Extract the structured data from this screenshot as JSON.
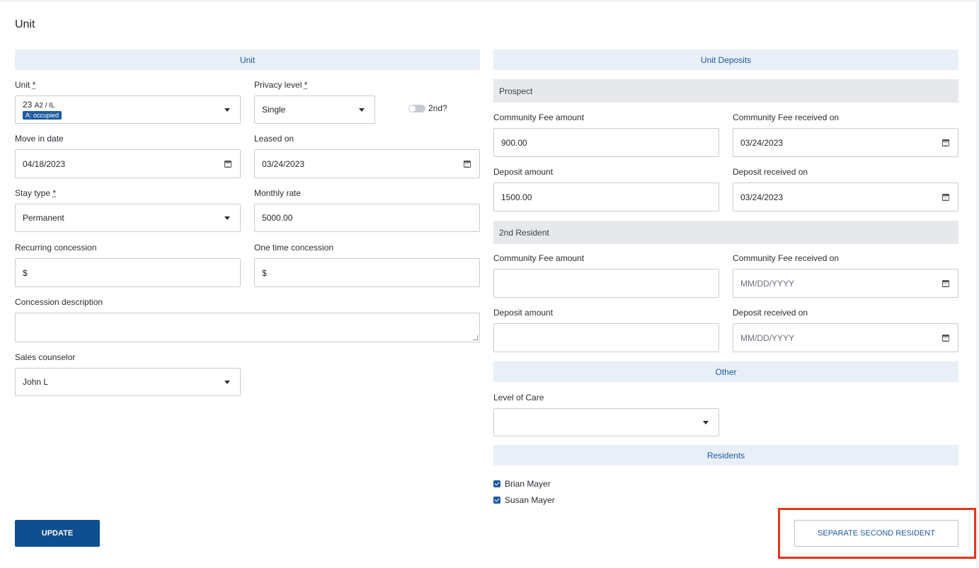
{
  "page": {
    "title": "Unit"
  },
  "left": {
    "section_title": "Unit",
    "unit": {
      "label": "Unit",
      "required": "*",
      "number": "23",
      "detail": "A2 / IL",
      "badge": "A: occupied"
    },
    "privacy": {
      "label": "Privacy level",
      "required": "*",
      "value": "Single",
      "toggle_label": "2nd?"
    },
    "move_in": {
      "label": "Move in date",
      "value": "04/18/2023"
    },
    "leased_on": {
      "label": "Leased on",
      "value": "03/24/2023"
    },
    "stay_type": {
      "label": "Stay type",
      "required": "*",
      "value": "Permanent"
    },
    "monthly_rate": {
      "label": "Monthly rate",
      "value": "5000.00"
    },
    "recurring_concession": {
      "label": "Recurring concession",
      "prefix": "$"
    },
    "one_time_concession": {
      "label": "One time concession",
      "prefix": "$"
    },
    "concession_description": {
      "label": "Concession description"
    },
    "sales_counselor": {
      "label": "Sales counselor",
      "value": "John L"
    },
    "update_button": "UPDATE"
  },
  "right": {
    "section_title": "Unit Deposits",
    "prospect": {
      "title": "Prospect",
      "community_fee_amount": {
        "label": "Community Fee amount",
        "value": "900.00"
      },
      "community_fee_received": {
        "label": "Community Fee received on",
        "value": "03/24/2023"
      },
      "deposit_amount": {
        "label": "Deposit amount",
        "value": "1500.00"
      },
      "deposit_received": {
        "label": "Deposit received on",
        "value": "03/24/2023"
      }
    },
    "second_resident": {
      "title": "2nd Resident",
      "community_fee_amount": {
        "label": "Community Fee amount",
        "value": ""
      },
      "community_fee_received": {
        "label": "Community Fee received on",
        "placeholder": "MM/DD/YYYY"
      },
      "deposit_amount": {
        "label": "Deposit amount",
        "value": ""
      },
      "deposit_received": {
        "label": "Deposit received on",
        "placeholder": "MM/DD/YYYY"
      }
    },
    "other": {
      "title": "Other",
      "level_of_care": {
        "label": "Level of Care",
        "value": ""
      }
    },
    "residents": {
      "title": "Residents",
      "items": [
        {
          "name": "Brian Mayer",
          "checked": true
        },
        {
          "name": "Susan Mayer",
          "checked": true
        }
      ]
    },
    "separate_button": "SEPARATE SECOND RESIDENT"
  },
  "colors": {
    "accent": "#1d5aa0",
    "primary_button": "#0f4f8f",
    "highlight": "#e8331c",
    "section_bg": "#e8eff7",
    "subsection_bg": "#e6e8ec"
  }
}
